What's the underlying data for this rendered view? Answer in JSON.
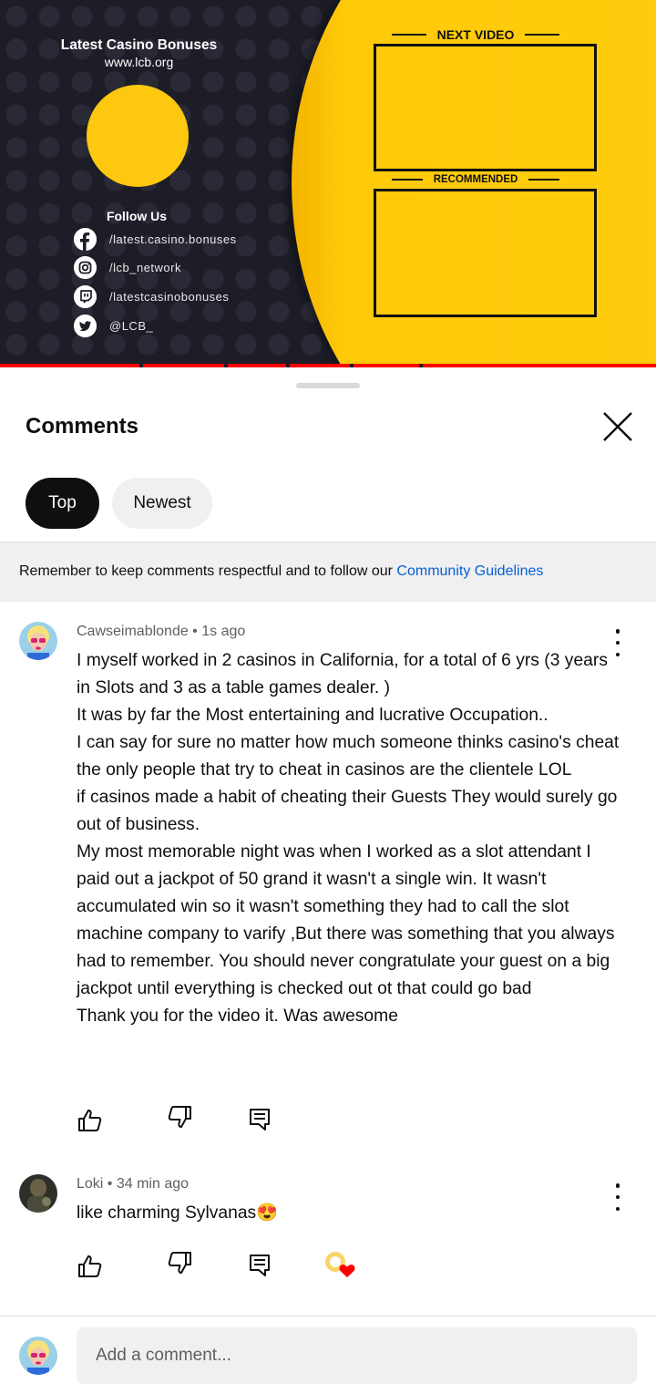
{
  "video": {
    "brand_title": "Latest Casino Bonuses",
    "brand_site": "www.lcb.org",
    "follow_label": "Follow Us",
    "socials": [
      {
        "icon": "facebook-icon",
        "handle": "/latest.casino.bonuses"
      },
      {
        "icon": "instagram-icon",
        "handle": "/lcb_network"
      },
      {
        "icon": "twitch-icon",
        "handle": "/latestcasinobonuses"
      },
      {
        "icon": "twitter-icon",
        "handle": "@LCB_"
      }
    ],
    "next_video_label": "NEXT VIDEO",
    "recommended_label": "RECOMMENDED",
    "accent_yellow": "#ffcd0c",
    "progress_color": "#ff0000"
  },
  "comments_panel": {
    "title": "Comments",
    "close_icon": "close-icon",
    "sort_chips": [
      {
        "label": "Top",
        "selected": true
      },
      {
        "label": "Newest",
        "selected": false
      }
    ],
    "notice_text": "Remember to keep comments respectful and to follow our ",
    "notice_link": "Community Guidelines",
    "link_color": "#065fd4"
  },
  "comments": [
    {
      "author": "Cawseimablonde",
      "time": "1s ago",
      "meta": "Cawseimablonde • 1s ago",
      "text": "I myself worked in 2 casinos in California, for a total of 6 yrs (3 years in Slots and 3 as a table games dealer. )\nIt was by far the Most entertaining and lucrative Occupation..\nI can say for sure no matter how much someone thinks casino's cheat the only people that try to cheat in casinos are the clientele LOL\nif casinos made a habit of cheating their Guests They would surely go out of business.\nMy most memorable night was when I worked as a slot attendant I paid out a jackpot of 50 grand it wasn't a single win. It wasn't accumulated win so it wasn't something they had to call the slot machine company to varify ,But there was something that you always had to remember. You should never congratulate your guest on a big jackpot until everything is checked out ot that could go bad\nThank you for the video it. Was awesome"
    },
    {
      "author": "Loki",
      "time": "34 min ago",
      "meta": "Loki • 34 min ago",
      "text": "like charming Sylvanas😍",
      "creator_hearted": true
    }
  ],
  "add_comment": {
    "placeholder": "Add a comment..."
  }
}
